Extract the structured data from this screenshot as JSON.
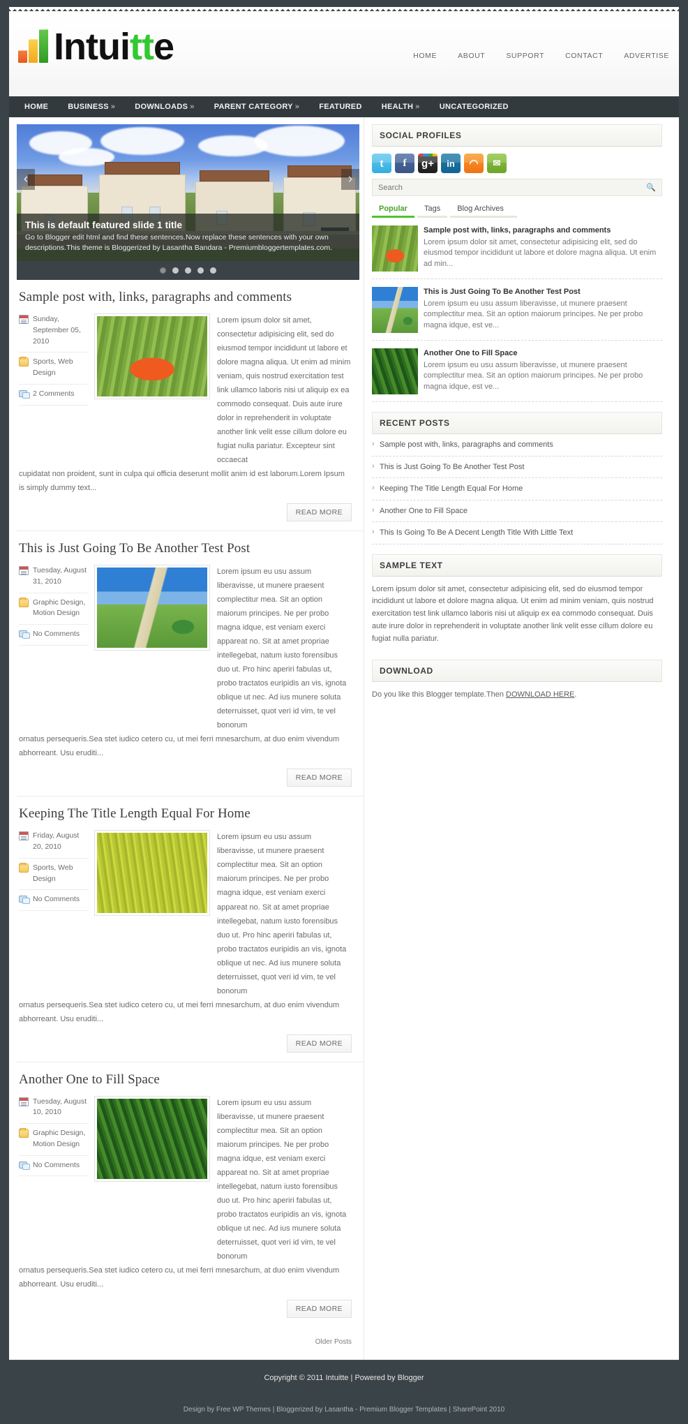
{
  "site": {
    "logo_text_dark_1": "Intui",
    "logo_text_green": "tt",
    "logo_text_dark_2": "e"
  },
  "topnav": {
    "items": [
      {
        "label": "HOME"
      },
      {
        "label": "ABOUT"
      },
      {
        "label": "SUPPORT"
      },
      {
        "label": "CONTACT"
      },
      {
        "label": "ADVERTISE"
      }
    ]
  },
  "mainnav": {
    "items": [
      {
        "label": "HOME",
        "caret": ""
      },
      {
        "label": "BUSINESS",
        "caret": "»"
      },
      {
        "label": "DOWNLOADS",
        "caret": "»"
      },
      {
        "label": "PARENT CATEGORY",
        "caret": "»"
      },
      {
        "label": "FEATURED",
        "caret": ""
      },
      {
        "label": "HEALTH",
        "caret": "»"
      },
      {
        "label": "UNCATEGORIZED",
        "caret": ""
      }
    ]
  },
  "slider": {
    "title": "This is default featured slide 1 title",
    "description": "Go to Blogger edit html and find these sentences.Now replace these sentences with your own descriptions.This theme is Bloggerized by Lasantha Bandara - Premiumbloggertemplates.com.",
    "prev_arrow": "‹",
    "next_arrow": "›",
    "dots": 5,
    "active_dot": 0
  },
  "posts": [
    {
      "title": "Sample post with, links, paragraphs and comments",
      "date": "Sunday, September 05, 2010",
      "categories": "Sports, Web Design",
      "comments": "2 Comments",
      "excerpt": "Lorem ipsum dolor sit amet, consectetur adipisicing elit, sed do eiusmod tempor incididunt ut labore et dolore magna aliqua. Ut enim ad minim veniam, quis nostrud exercitation test link ullamco laboris nisi ut aliquip ex ea commodo consequat. Duis aute irure dolor in reprehenderit in voluptate another link velit esse cillum dolore eu fugiat nulla pariatur. Excepteur sint occaecat",
      "excerpt_tail": "cupidatat non proident, sunt in culpa qui officia deserunt mollit anim id est laborum.Lorem Ipsum is simply dummy text...",
      "read_more": "READ MORE",
      "thumb": "img-umbrella"
    },
    {
      "title": "This is Just Going To Be Another Test Post",
      "date": "Tuesday, August 31, 2010",
      "categories": "Graphic Design, Motion Design",
      "comments": "No Comments",
      "excerpt": "Lorem ipsum eu usu assum liberavisse, ut munere praesent complectitur mea. Sit an option maiorum principes. Ne per probo magna idque, est veniam exerci appareat no. Sit at amet propriae intellegebat, natum iusto forensibus duo ut. Pro hinc aperiri fabulas ut, probo tractatos euripidis an vis, ignota oblique ut nec. Ad ius munere soluta deterruisset, quot veri id vim, te vel bonorum",
      "excerpt_tail": "ornatus persequeris.Sea stet iudico cetero cu, ut mei ferri mnesarchum, at duo enim vivendum abhorreant. Usu eruditi...",
      "read_more": "READ MORE",
      "thumb": "img-road"
    },
    {
      "title": "Keeping The Title Length Equal For Home",
      "date": "Friday, August 20, 2010",
      "categories": "Sports, Web Design",
      "comments": "No Comments",
      "excerpt": "Lorem ipsum eu usu assum liberavisse, ut munere praesent complectitur mea. Sit an option maiorum principes. Ne per probo magna idque, est veniam exerci appareat no. Sit at amet propriae intellegebat, natum iusto forensibus duo ut. Pro hinc aperiri fabulas ut, probo tractatos euripidis an vis, ignota oblique ut nec. Ad ius munere soluta deterruisset, quot veri id vim, te vel bonorum",
      "excerpt_tail": "ornatus persequeris.Sea stet iudico cetero cu, ut mei ferri mnesarchum, at duo enim vivendum abhorreant. Usu eruditi...",
      "read_more": "READ MORE",
      "thumb": "img-wheat"
    },
    {
      "title": "Another One to Fill Space",
      "date": "Tuesday, August 10, 2010",
      "categories": "Graphic Design, Motion Design",
      "comments": "No Comments",
      "excerpt": "Lorem ipsum eu usu assum liberavisse, ut munere praesent complectitur mea. Sit an option maiorum principes. Ne per probo magna idque, est veniam exerci appareat no. Sit at amet propriae intellegebat, natum iusto forensibus duo ut. Pro hinc aperiri fabulas ut, probo tractatos euripidis an vis, ignota oblique ut nec. Ad ius munere soluta deterruisset, quot veri id vim, te vel bonorum",
      "excerpt_tail": "ornatus persequeris.Sea stet iudico cetero cu, ut mei ferri mnesarchum, at duo enim vivendum abhorreant. Usu eruditi...",
      "read_more": "READ MORE",
      "thumb": "img-grass"
    }
  ],
  "pagination": {
    "older_posts": "Older Posts"
  },
  "sidebar": {
    "social": {
      "heading": "SOCIAL PROFILES",
      "icons": [
        {
          "name": "twitter-icon",
          "glyph": "t"
        },
        {
          "name": "facebook-icon",
          "glyph": "f"
        },
        {
          "name": "google-plus-icon",
          "glyph": "g+"
        },
        {
          "name": "linkedin-icon",
          "glyph": "in"
        },
        {
          "name": "rss-icon",
          "glyph": "◠"
        },
        {
          "name": "email-icon",
          "glyph": "✉"
        }
      ]
    },
    "search": {
      "placeholder": "Search",
      "value": "",
      "icon": "search-icon"
    },
    "tabs": [
      {
        "label": "Popular",
        "active": true
      },
      {
        "label": "Tags",
        "active": false
      },
      {
        "label": "Blog Archives",
        "active": false
      }
    ],
    "popular": [
      {
        "title": "Sample post with, links, paragraphs and comments",
        "excerpt": "Lorem ipsum dolor sit amet, consectetur adipisicing elit, sed do eiusmod tempor incididunt ut labore et dolore magna aliqua. Ut enim ad min...",
        "thumb": "img-umbrella"
      },
      {
        "title": "This is Just Going To Be Another Test Post",
        "excerpt": "Lorem ipsum eu usu assum liberavisse, ut munere praesent complectitur mea. Sit an option maiorum principes. Ne per probo magna idque, est ve...",
        "thumb": "img-road"
      },
      {
        "title": "Another One to Fill Space",
        "excerpt": "Lorem ipsum eu usu assum liberavisse, ut munere praesent complectitur mea. Sit an option maiorum principes. Ne per probo magna idque, est ve...",
        "thumb": "img-grass"
      }
    ],
    "recent": {
      "heading": "RECENT POSTS",
      "items": [
        {
          "label": "Sample post with, links, paragraphs and comments"
        },
        {
          "label": "This is Just Going To Be Another Test Post"
        },
        {
          "label": "Keeping The Title Length Equal For Home"
        },
        {
          "label": "Another One to Fill Space"
        },
        {
          "label": "This Is Going To Be A Decent Length Title With Little Text"
        }
      ]
    },
    "sample": {
      "heading": "SAMPLE TEXT",
      "body": "Lorem ipsum dolor sit amet, consectetur adipisicing elit, sed do eiusmod tempor incididunt ut labore et dolore magna aliqua. Ut enim ad minim veniam, quis nostrud exercitation test link ullamco laboris nisi ut aliquip ex ea commodo consequat. Duis aute irure dolor in reprehenderit in voluptate another link velit esse cillum dolore eu fugiat nulla pariatur."
    },
    "download": {
      "heading": "DOWNLOAD",
      "lead": "Do you like this Blogger template.Then ",
      "link": "DOWNLOAD HERE",
      "tail": "."
    }
  },
  "footer": {
    "copyright": "Copyright © 2011 Intuitte | Powered by Blogger",
    "credits": "Design by Free WP Themes | Bloggerized by Lasantha - Premium Blogger Templates | SharePoint 2010"
  },
  "colors": {
    "dark": "#3a4347",
    "nav": "#323a3e",
    "accent_green": "#4dc42a",
    "logo_green": "#32c832"
  }
}
